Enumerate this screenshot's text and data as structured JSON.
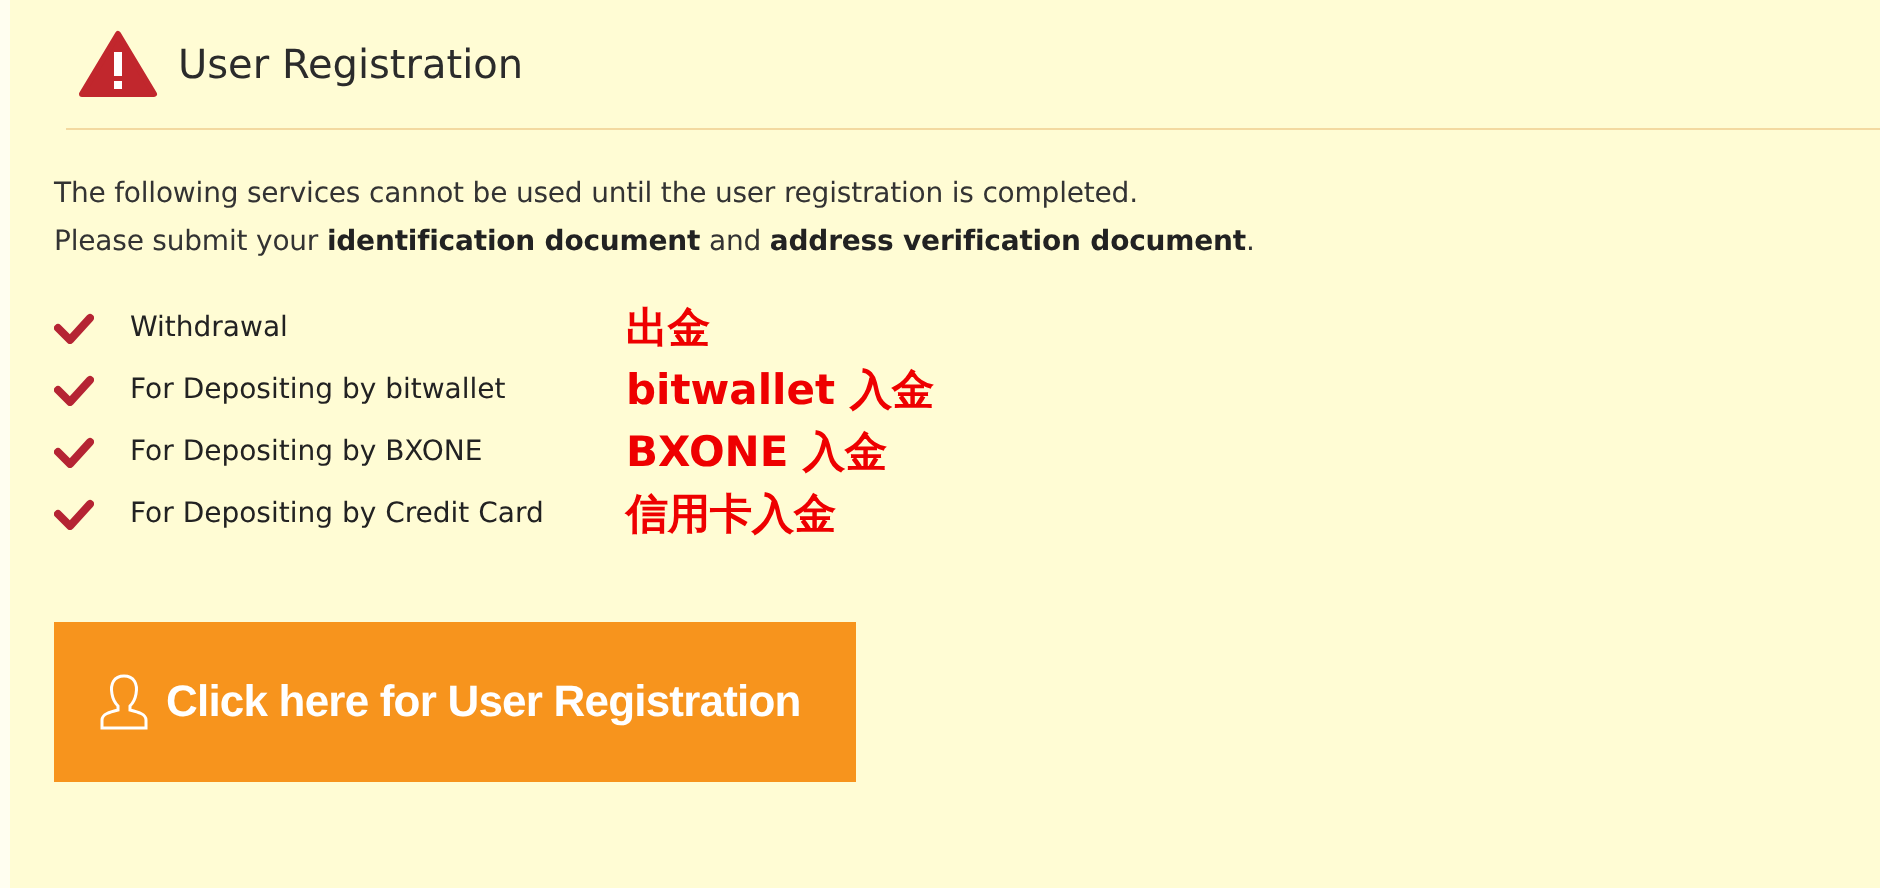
{
  "header": {
    "title": "User Registration"
  },
  "intro": [
    "The following services cannot be used until the user registration is completed.",
    "Please submit your **identification document** and **address verification document**."
  ],
  "services": [
    {
      "label": "Withdrawal",
      "annotation": "出金"
    },
    {
      "label": "For Depositing by bitwallet",
      "annotation": "bitwallet 入金"
    },
    {
      "label": "For Depositing by BXONE",
      "annotation": "BXONE 入金"
    },
    {
      "label": "For Depositing by Credit Card",
      "annotation": "信用卡入金"
    }
  ],
  "button": {
    "label": "Click here for User Registration"
  }
}
